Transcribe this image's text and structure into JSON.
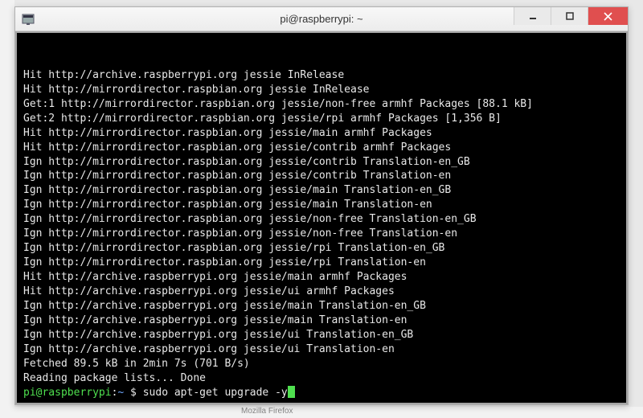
{
  "window": {
    "title": "pi@raspberrypi: ~"
  },
  "terminal": {
    "lines": [
      "Hit http://archive.raspberrypi.org jessie InRelease",
      "Hit http://mirrordirector.raspbian.org jessie InRelease",
      "Get:1 http://mirrordirector.raspbian.org jessie/non-free armhf Packages [88.1 kB]",
      "Get:2 http://mirrordirector.raspbian.org jessie/rpi armhf Packages [1,356 B]",
      "Hit http://mirrordirector.raspbian.org jessie/main armhf Packages",
      "Hit http://mirrordirector.raspbian.org jessie/contrib armhf Packages",
      "Ign http://mirrordirector.raspbian.org jessie/contrib Translation-en_GB",
      "Ign http://mirrordirector.raspbian.org jessie/contrib Translation-en",
      "Ign http://mirrordirector.raspbian.org jessie/main Translation-en_GB",
      "Ign http://mirrordirector.raspbian.org jessie/main Translation-en",
      "Ign http://mirrordirector.raspbian.org jessie/non-free Translation-en_GB",
      "Ign http://mirrordirector.raspbian.org jessie/non-free Translation-en",
      "Ign http://mirrordirector.raspbian.org jessie/rpi Translation-en_GB",
      "Ign http://mirrordirector.raspbian.org jessie/rpi Translation-en",
      "Hit http://archive.raspberrypi.org jessie/main armhf Packages",
      "Hit http://archive.raspberrypi.org jessie/ui armhf Packages",
      "Ign http://archive.raspberrypi.org jessie/main Translation-en_GB",
      "Ign http://archive.raspberrypi.org jessie/main Translation-en",
      "Ign http://archive.raspberrypi.org jessie/ui Translation-en_GB",
      "Ign http://archive.raspberrypi.org jessie/ui Translation-en",
      "Fetched 89.5 kB in 2min 7s (701 B/s)",
      "Reading package lists... Done"
    ],
    "prompt": {
      "user_host": "pi@raspberrypi",
      "colon": ":",
      "path": "~",
      "dollar": " $ ",
      "command": "sudo apt-get upgrade -y"
    }
  },
  "background": {
    "taskbar_hint": "Mozilla Firefox"
  }
}
